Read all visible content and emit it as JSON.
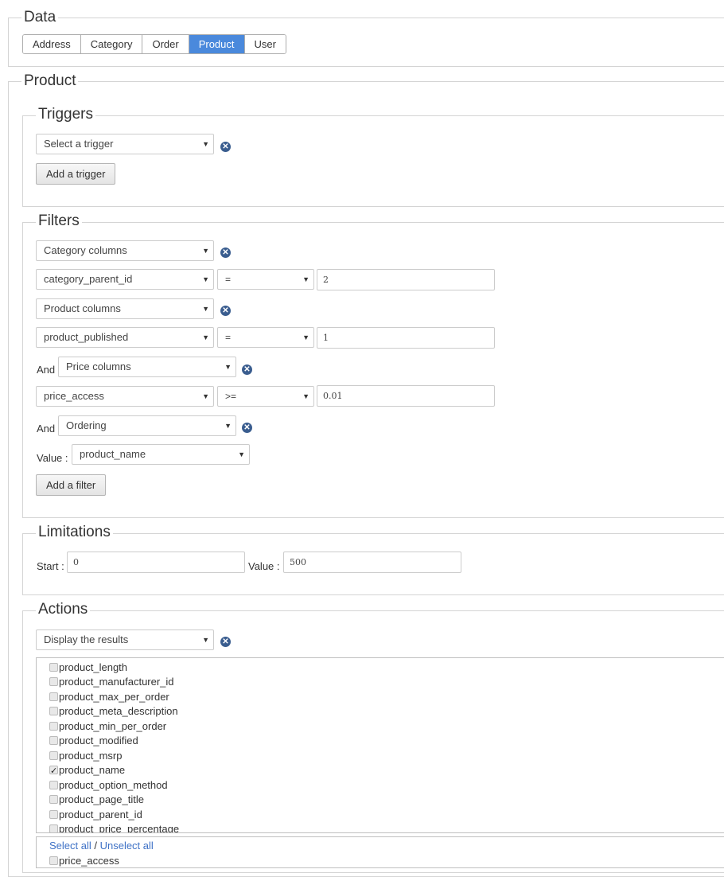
{
  "data_section": {
    "legend": "Data",
    "tabs": [
      {
        "label": "Address",
        "active": false
      },
      {
        "label": "Category",
        "active": false
      },
      {
        "label": "Order",
        "active": false
      },
      {
        "label": "Product",
        "active": true
      },
      {
        "label": "User",
        "active": false
      }
    ]
  },
  "product_section": {
    "legend": "Product",
    "triggers": {
      "legend": "Triggers",
      "select_value": "Select a trigger",
      "add_button": "Add a trigger"
    },
    "filters": {
      "legend": "Filters",
      "rows": {
        "group1": "Category columns",
        "cond1_column": "category_parent_id",
        "cond1_operator": "=",
        "cond1_value": "2",
        "group2": "Product columns",
        "cond2_column": "product_published",
        "cond2_operator": "=",
        "cond2_value": "1",
        "and_label_1": "And",
        "group3": "Price columns",
        "cond3_column": "price_access",
        "cond3_operator": ">=",
        "cond3_value": "0.01",
        "and_label_2": "And",
        "group4": "Ordering",
        "value_label": "Value :",
        "ordering_value": "product_name"
      },
      "add_button": "Add a filter"
    },
    "limitations": {
      "legend": "Limitations",
      "start_label": "Start :",
      "start_value": "0",
      "value_label": "Value :",
      "value_value": "500"
    },
    "actions": {
      "legend": "Actions",
      "select_value": "Display the results",
      "columns": [
        {
          "name": "product_length",
          "checked": false
        },
        {
          "name": "product_manufacturer_id",
          "checked": false
        },
        {
          "name": "product_max_per_order",
          "checked": false
        },
        {
          "name": "product_meta_description",
          "checked": false
        },
        {
          "name": "product_min_per_order",
          "checked": false
        },
        {
          "name": "product_modified",
          "checked": false
        },
        {
          "name": "product_msrp",
          "checked": false
        },
        {
          "name": "product_name",
          "checked": true
        },
        {
          "name": "product_option_method",
          "checked": false
        },
        {
          "name": "product_page_title",
          "checked": false
        },
        {
          "name": "product_parent_id",
          "checked": false
        },
        {
          "name": "product_price_percentage",
          "checked": false
        }
      ],
      "select_all": "Select all",
      "separator": " / ",
      "unselect_all": "Unselect all",
      "price_columns": [
        {
          "name": "price_access",
          "checked": false
        }
      ]
    }
  },
  "icons": {
    "remove": "remove-circle-icon",
    "dropdown": "dropdown-arrow-icon",
    "checkbox": "checkbox-icon"
  },
  "colors": {
    "active_tab": "#4a89dc",
    "remove_icon": "#3a5d8f",
    "link": "#3f72c6"
  }
}
